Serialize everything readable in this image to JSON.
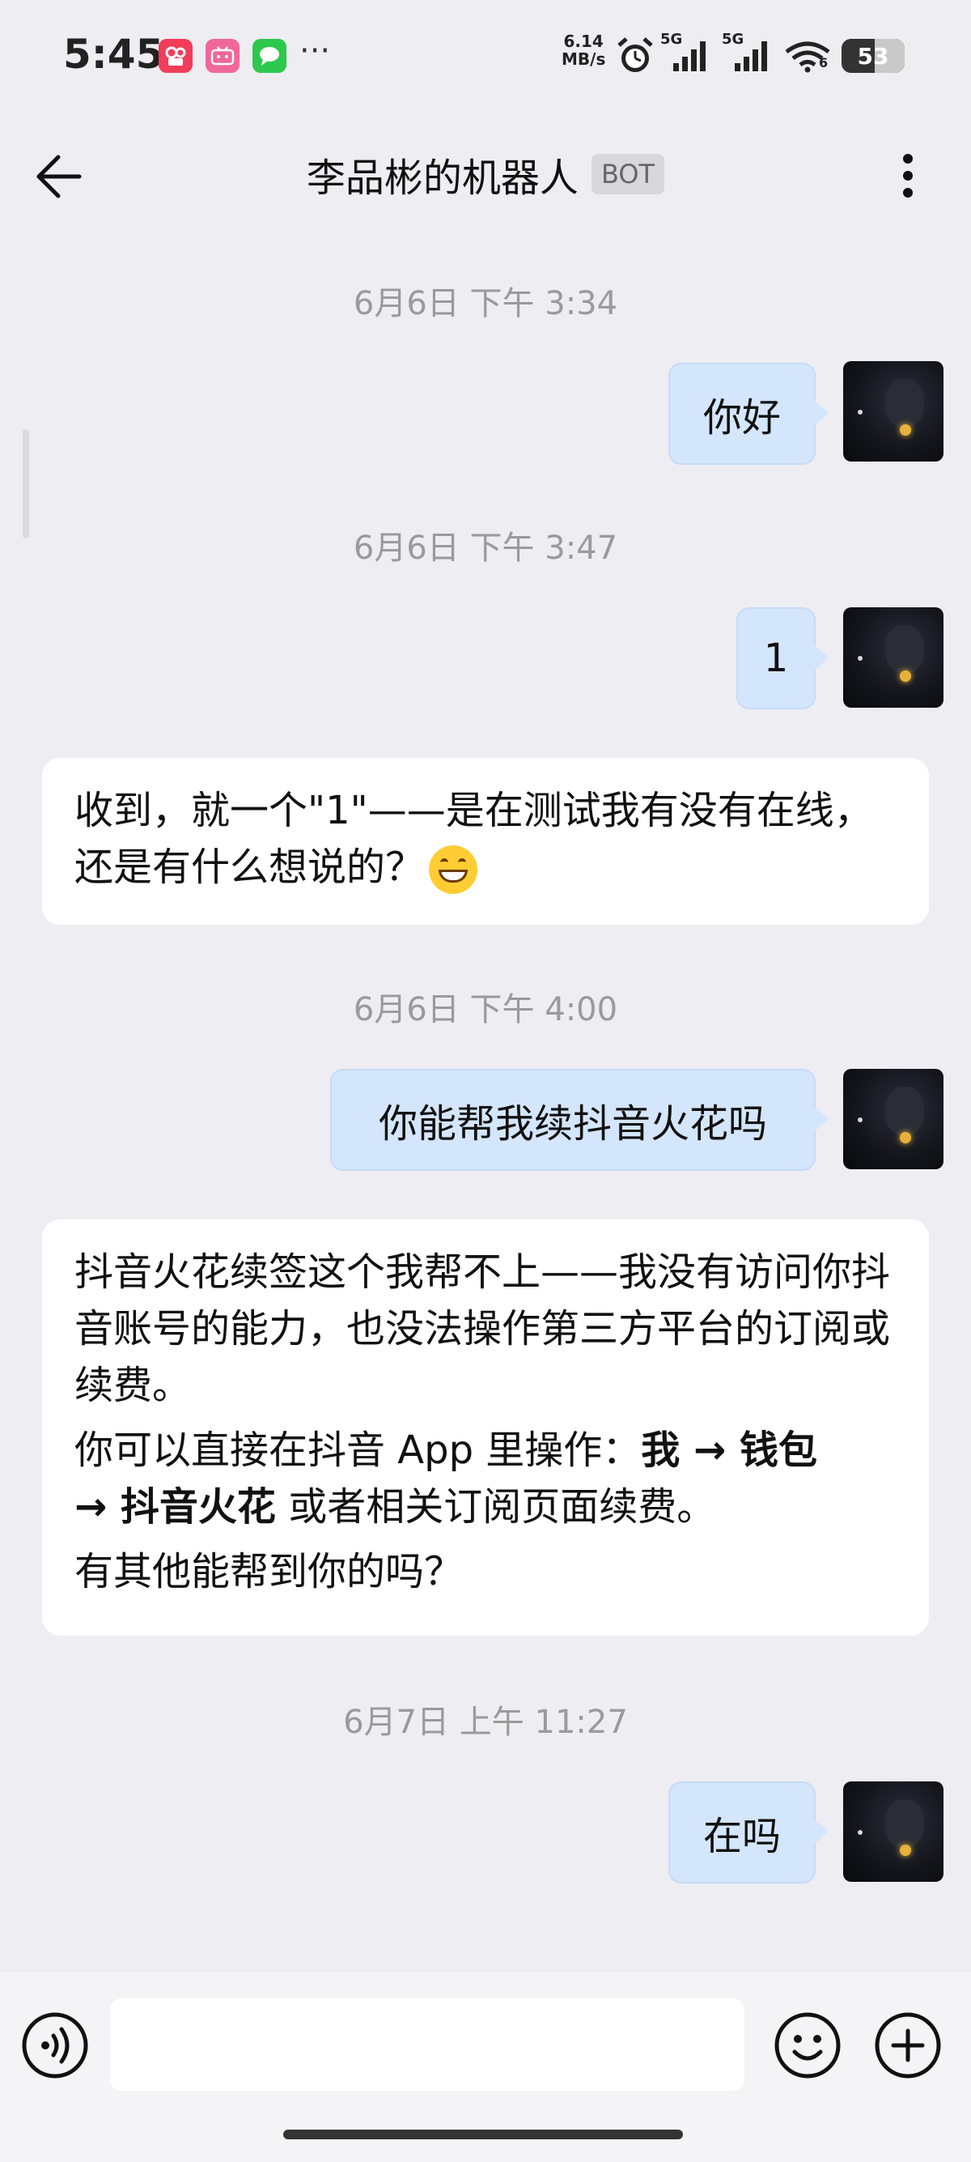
{
  "status_bar": {
    "time": "5:45",
    "dots": "···",
    "net_speed_value": "6.14",
    "net_speed_unit": "MB/s",
    "signal1_label": "5G",
    "signal2_label": "5G",
    "wifi_label": "6",
    "battery": "53",
    "app_icons": [
      "kuaishou-icon",
      "bilibili-icon",
      "messages-icon"
    ]
  },
  "header": {
    "title": "李品彬的机器人",
    "badge": "BOT"
  },
  "messages": [
    {
      "type": "timestamp",
      "text": "6月6日  下午 3:34"
    },
    {
      "type": "me",
      "text": "你好"
    },
    {
      "type": "timestamp",
      "text": "6月6日  下午 3:47"
    },
    {
      "type": "me",
      "text": "1"
    },
    {
      "type": "bot",
      "text": "收到，就一个\"1\"——是在测试我有没有在线，还是有什么想说的？"
    },
    {
      "type": "timestamp",
      "text": "6月6日  下午 4:00"
    },
    {
      "type": "me",
      "text": "你能帮我续抖音火花吗"
    },
    {
      "type": "bot",
      "p1": "抖音火花续签这个我帮不上——我没有访问你抖音账号的能力，也没法操作第三方平台的订阅或续费。",
      "p2_prefix": "你可以直接在抖音 App 里操作：",
      "p2_bold1": "我 → 钱包",
      "p2_bold2": "→ 抖音火花",
      "p2_suffix": " 或者相关订阅页面续费。",
      "p3": "有其他能帮到你的吗？"
    },
    {
      "type": "timestamp",
      "text": "6月7日  上午 11:27"
    },
    {
      "type": "me",
      "text": "在吗"
    }
  ],
  "input": {
    "value": "",
    "placeholder": ""
  },
  "colors": {
    "background": "#EDEDF2",
    "my_bubble": "#D4E6FC",
    "bot_bubble": "#FFFFFF",
    "timestamp": "#9A9A9A"
  }
}
